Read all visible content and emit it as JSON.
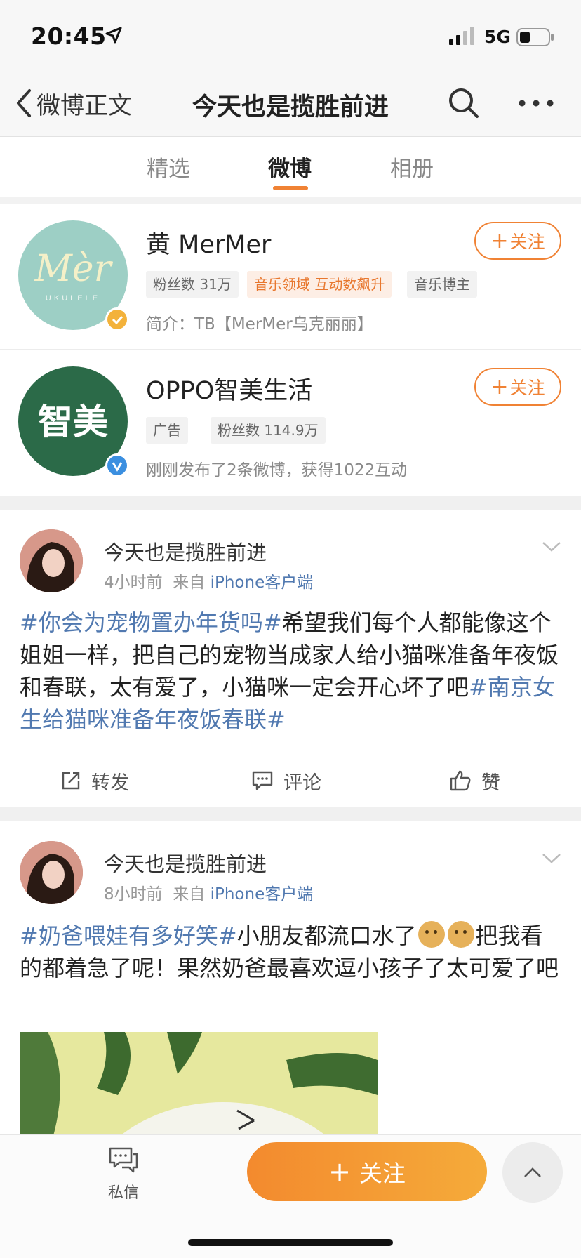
{
  "status_bar": {
    "time": "20:45",
    "network": "5G"
  },
  "navbar": {
    "back_label": "微博正文",
    "title": "今天也是揽胜前进"
  },
  "tabs": [
    {
      "label": "精选",
      "active": false
    },
    {
      "label": "微博",
      "active": true
    },
    {
      "label": "相册",
      "active": false
    }
  ],
  "accent_color": "#f08234",
  "link_color": "#5179b0",
  "cards": [
    {
      "name": "黄 MerMer",
      "follow_label": "关注",
      "avatar_text": "Mèr",
      "avatar_subtext": "UKULELE",
      "tags": [
        "粉丝数 31万",
        "音乐领域 互动数飙升",
        "音乐博主"
      ],
      "description": "简介：TB【MerMer乌克丽丽】"
    },
    {
      "name": "OPPO智美生活",
      "follow_label": "关注",
      "avatar_text": "智美",
      "tags": [
        "广告",
        "粉丝数 114.9万"
      ],
      "description": "刚刚发布了2条微博，获得1022互动"
    }
  ],
  "posts": [
    {
      "user": "今天也是揽胜前进",
      "time": "4小时前",
      "from_label": "来自",
      "source": "iPhone客户端",
      "hashtag1": "#你会为宠物置办年货吗#",
      "text1": "希望我们每个人都能像这个姐姐一样，把自己的宠物当成家人给小猫咪准备年夜饭和春联，太有爱了，小猫咪一定会开心坏了吧",
      "hashtag2": "#南京女生给猫咪准备年夜饭春联#",
      "actions": {
        "repost": "转发",
        "comment": "评论",
        "like": "赞"
      }
    },
    {
      "user": "今天也是揽胜前进",
      "time": "8小时前",
      "from_label": "来自",
      "source": "iPhone客户端",
      "hashtag1": "#奶爸喂娃有多好笑#",
      "text1": "小朋友都流口水了",
      "text2": "把我看的都着急了呢！果然奶爸最喜欢逗小孩子了太可爱了吧"
    }
  ],
  "bottom_bar": {
    "dm_label": "私信",
    "follow_label": "关注"
  }
}
